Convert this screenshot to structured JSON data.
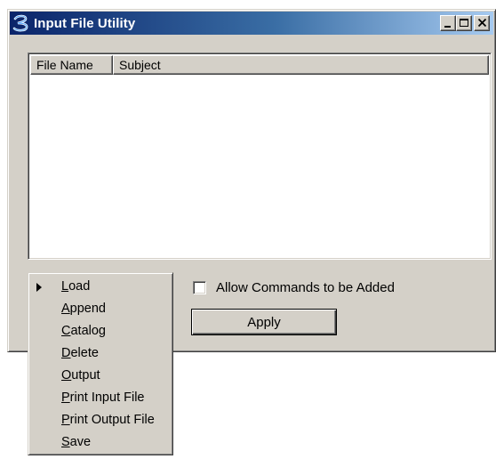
{
  "window": {
    "title": "Input File Utility",
    "icon": "bentley-b-icon"
  },
  "list": {
    "columns": [
      "File Name",
      "Subject"
    ],
    "rows": []
  },
  "options": {
    "allow_commands_label": "Allow Commands to be Added",
    "allow_commands_checked": false,
    "apply_label": "Apply"
  },
  "menu": {
    "selected": "Load",
    "items": [
      {
        "mnemonic": "L",
        "rest": "oad",
        "checked": true
      },
      {
        "mnemonic": "A",
        "rest": "ppend",
        "checked": false
      },
      {
        "mnemonic": "C",
        "rest": "atalog",
        "checked": false
      },
      {
        "mnemonic": "D",
        "rest": "elete",
        "checked": false
      },
      {
        "mnemonic": "O",
        "rest": "utput",
        "checked": false
      },
      {
        "mnemonic": "P",
        "rest": "rint Input File",
        "checked": false
      },
      {
        "mnemonic": "P",
        "rest": "rint Output File",
        "checked": false
      },
      {
        "mnemonic": "S",
        "rest": "ave",
        "checked": false
      }
    ]
  }
}
